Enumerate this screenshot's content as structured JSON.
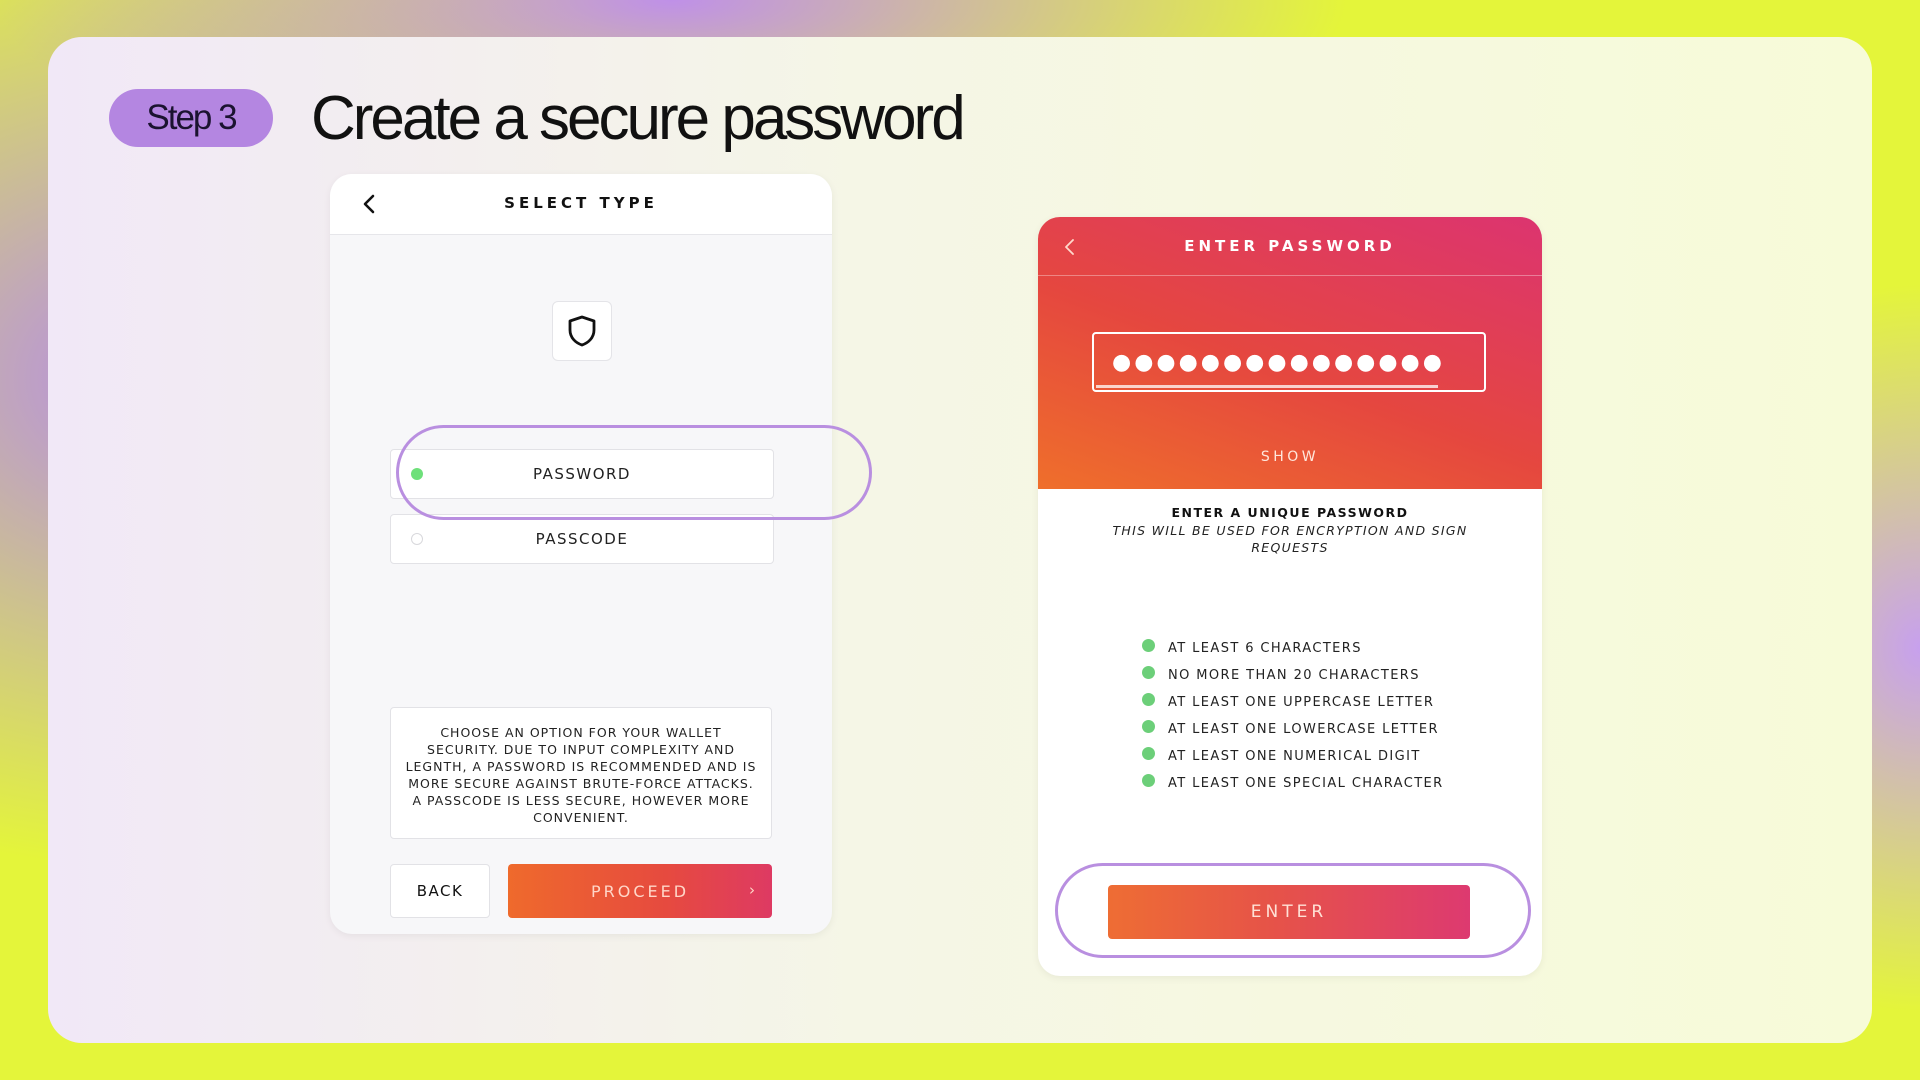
{
  "slide": {
    "step_label": "Step 3",
    "title": "Create a secure password"
  },
  "select_type_screen": {
    "header_title": "SELECT TYPE",
    "back_icon": "chevron-left-icon",
    "shield_icon": "shield-icon",
    "options": [
      {
        "label": "PASSWORD",
        "selected": true
      },
      {
        "label": "PASSCODE",
        "selected": false
      }
    ],
    "info_text": "CHOOSE AN OPTION FOR YOUR WALLET SECURITY. DUE TO INPUT COMPLEXITY AND LEGNTH, A PASSWORD IS RECOMMENDED AND IS MORE SECURE AGAINST BRUTE-FORCE ATTACKS. A PASSCODE IS LESS SECURE, HOWEVER MORE CONVENIENT.",
    "back_button": "BACK",
    "proceed_button": "PROCEED",
    "proceed_chevron": "›"
  },
  "enter_password_screen": {
    "header_title": "ENTER PASSWORD",
    "back_icon": "chevron-left-icon",
    "password_masked": "●●●●●●●●●●●●●●●",
    "show_toggle": "SHOW",
    "heading": "ENTER A UNIQUE PASSWORD",
    "subheading": "THIS WILL BE USED FOR ENCRYPTION AND SIGN REQUESTS",
    "requirements": [
      {
        "text": "AT LEAST 6 CHARACTERS",
        "met": true
      },
      {
        "text": "NO MORE THAN 20 CHARACTERS",
        "met": true
      },
      {
        "text": "AT LEAST ONE UPPERCASE LETTER",
        "met": true
      },
      {
        "text": "AT LEAST ONE LOWERCASE LETTER",
        "met": true
      },
      {
        "text": "AT LEAST ONE NUMERICAL DIGIT",
        "met": true
      },
      {
        "text": "AT LEAST ONE SPECIAL CHARACTER",
        "met": true
      }
    ],
    "enter_button": "ENTER"
  },
  "colors": {
    "accent_purple": "#b486e1",
    "check_green": "#6ccf79",
    "gradient_orange": "#ef6f2b",
    "gradient_pink": "#dc3470"
  }
}
